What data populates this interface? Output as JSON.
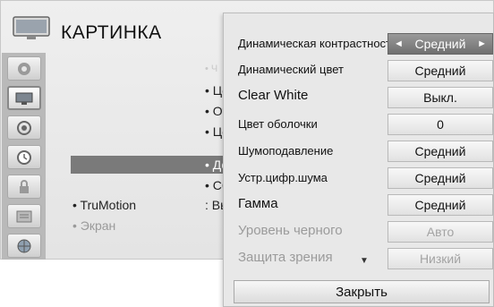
{
  "menu": {
    "title": "КАРТИНКА",
    "sidebar_icons": [
      "picture-icon",
      "screen-icon",
      "audio-icon",
      "time-icon",
      "lock-icon",
      "option-icon",
      "network-icon"
    ],
    "list": {
      "item_1": "• Ч",
      "item_2": "• Це",
      "item_3": "• От",
      "item_4": "• Це",
      "item_5": "• До",
      "item_6": "• Сб",
      "trumotion_label": "• TruMotion",
      "trumotion_value": ": Вь",
      "screen_label": "• Экран"
    }
  },
  "popup": {
    "rows": [
      {
        "label": "Динамическая контрастность",
        "value": "Средний"
      },
      {
        "label": "Динамический цвет",
        "value": "Средний"
      },
      {
        "label": "Clear White",
        "value": "Выкл."
      },
      {
        "label": "Цвет оболочки",
        "value": "0"
      },
      {
        "label": "Шумоподавление",
        "value": "Средний"
      },
      {
        "label": "Устр.цифр.шума",
        "value": "Средний"
      },
      {
        "label": "Гамма",
        "value": "Средний"
      },
      {
        "label": "Уровень черного",
        "value": "Авто"
      },
      {
        "label": "Защита зрения",
        "value": "Низкий"
      }
    ],
    "left_arrow": "◄",
    "right_arrow": "►",
    "scroll_indicator": "▼",
    "close_label": "Закрыть"
  }
}
